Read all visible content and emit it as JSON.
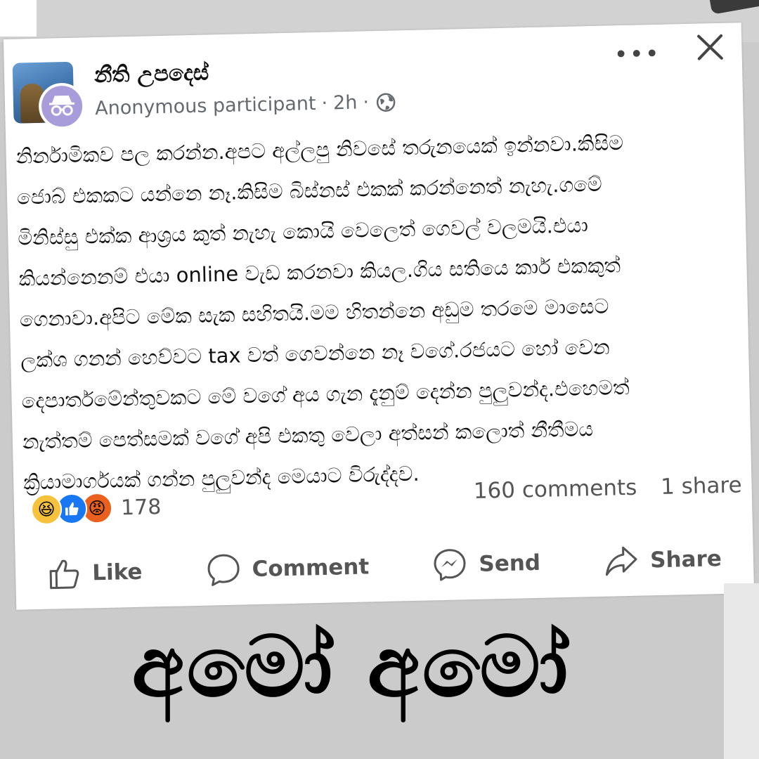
{
  "post": {
    "group_name": "නීති උපදෙස්",
    "author": "Anonymous participant",
    "separator": "·",
    "time": "2h",
    "body_lines": [
      "නිර්නාමිකව පල කරන්න.අපට අල්ලපු නිවසේ තරුනයෙක් ඉන්නවා.කිසිම",
      "ජොබ් එකකට යන්නෙ නෑ.කිසිම බිස්නස් එකක් කරන්නෙත් නැහැ.ගමේ",
      "මිනිස්සු එක්ක ආශ්‍රය කුත් නැහැ කොයි වෙලෙත් ගෙවල් වලමයි.එයා",
      "කියන්නෙනම් එයා online වැඩ කරනවා කියල.ගිය සතියෙ කාර් එකකුත්",
      "ගෙනාවා.අපිට මේක සැක සහිතයි.මම හිතන්නෙ අඩුම තරමෙ මාසෙට",
      "ලක්ශ ගනන් හෙව්වට tax වත් ගෙවන්නෙ නෑ වගේ.රජයට හෝ වෙන",
      "දෙපාර්තමේන්තුවකට මේ වගේ අය ගැන දැනුම් දෙන්න පුලුවන්ද.එහෙමත්",
      "නැත්තම් පෙත්සමක් වගේ අපි එකතු වෙලා අත්සන් කලොත් නීතීමය",
      "ක්‍රියාමාර්ගයක් ගන්න පුලුවන්ද මෙයාට විරුද්දව."
    ],
    "reaction_icons": [
      "haha-reaction",
      "like-reaction",
      "angry-reaction"
    ],
    "reaction_count": "178",
    "comments": "160 comments",
    "shares": "1 share"
  },
  "actions": {
    "like": "Like",
    "comment": "Comment",
    "send": "Send",
    "share": "Share"
  },
  "caption": "අමෝ අමෝ",
  "colors": {
    "background": "#cbcbcb",
    "card": "#ffffff",
    "meta_text": "#656a70",
    "like_blue": "#1877f2",
    "anon_avatar": "#a99cdb"
  }
}
